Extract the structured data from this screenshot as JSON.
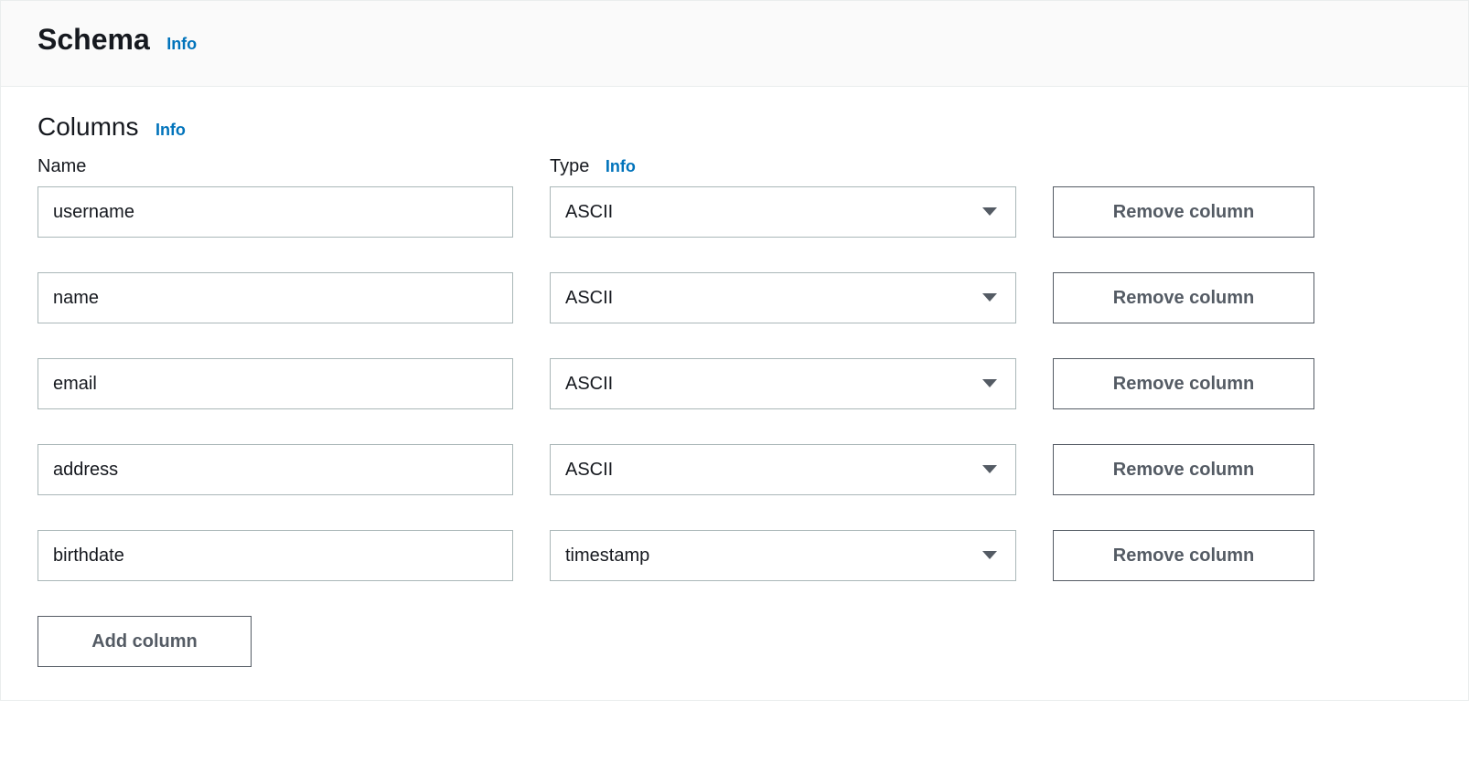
{
  "header": {
    "title": "Schema",
    "info_label": "Info"
  },
  "columns_section": {
    "title": "Columns",
    "info_label": "Info",
    "name_label": "Name",
    "type_label": "Type",
    "type_info_label": "Info"
  },
  "rows": [
    {
      "name": "username",
      "type": "ASCII",
      "remove_label": "Remove column"
    },
    {
      "name": "name",
      "type": "ASCII",
      "remove_label": "Remove column"
    },
    {
      "name": "email",
      "type": "ASCII",
      "remove_label": "Remove column"
    },
    {
      "name": "address",
      "type": "ASCII",
      "remove_label": "Remove column"
    },
    {
      "name": "birthdate",
      "type": "timestamp",
      "remove_label": "Remove column"
    }
  ],
  "add_button_label": "Add column"
}
